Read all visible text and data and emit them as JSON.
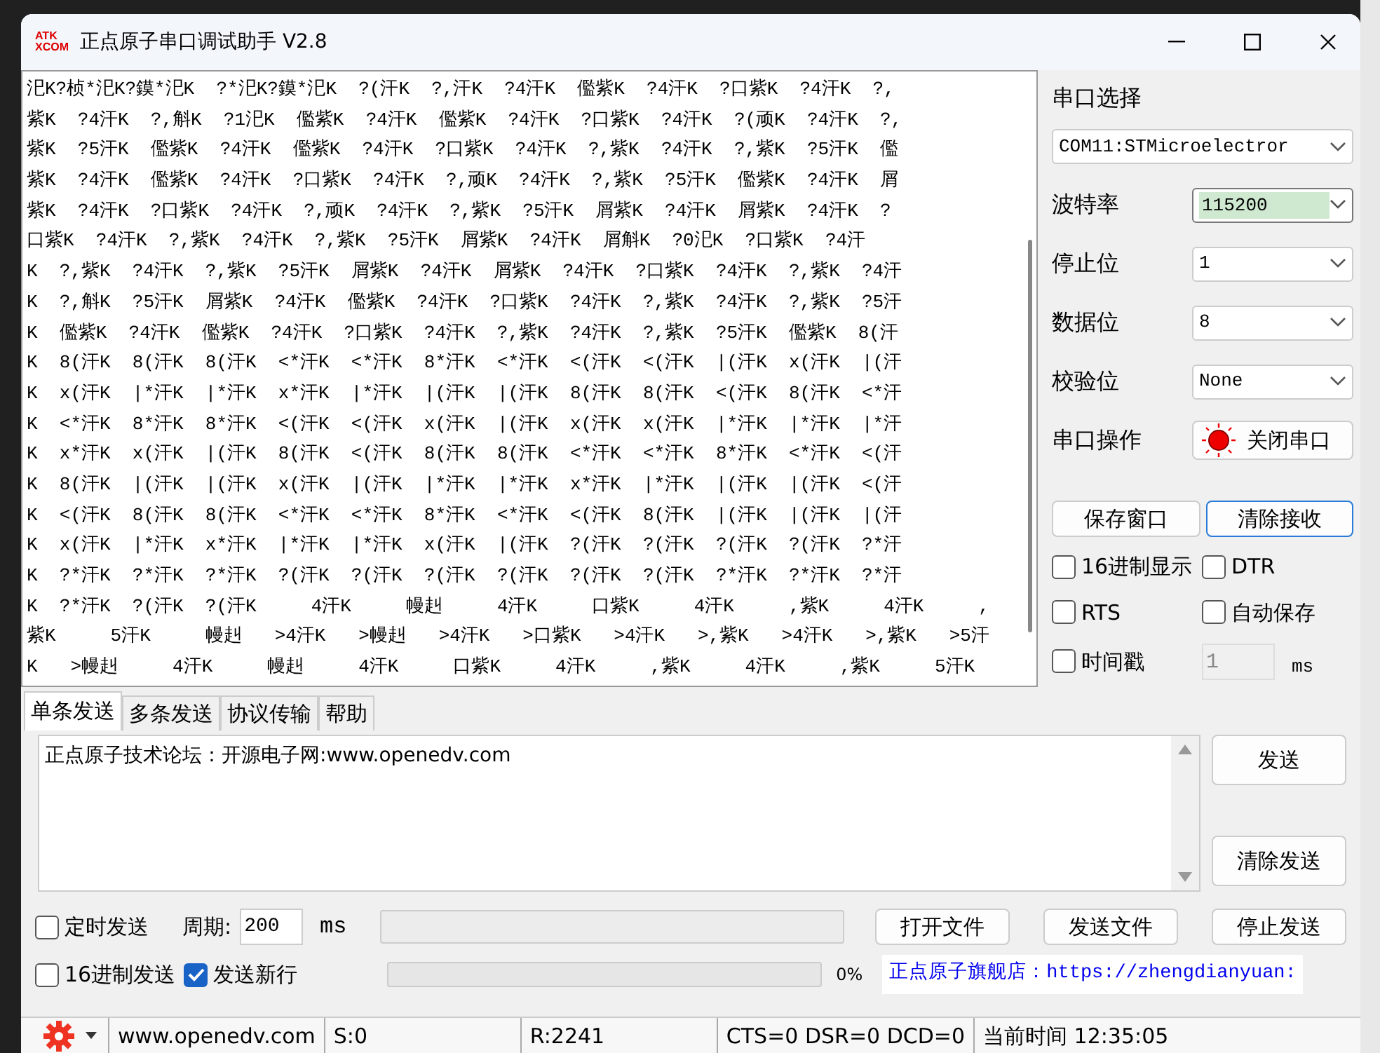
{
  "window": {
    "logo": [
      "ATK",
      "XCOM"
    ],
    "title": "正点原子串口调试助手 V2.8"
  },
  "receive": {
    "lines": [
      "汜K?桢*汜K?鏌*汜K  ?*汜K?鏌*汜K  ?(汗K  ?,汗K  ?4汗K  儖紫K  ?4汗K  ?口紫K  ?4汗K  ?,",
      "紫K  ?4汗K  ?,斛K  ?1汜K  儖紫K  ?4汗K  儖紫K  ?4汗K  ?口紫K  ?4汗K  ?(顽K  ?4汗K  ?,",
      "紫K  ?5汗K  儖紫K  ?4汗K  儖紫K  ?4汗K  ?口紫K  ?4汗K  ?,紫K  ?4汗K  ?,紫K  ?5汗K  儖",
      "紫K  ?4汗K  儖紫K  ?4汗K  ?口紫K  ?4汗K  ?,顽K  ?4汗K  ?,紫K  ?5汗K  儖紫K  ?4汗K  屑",
      "紫K  ?4汗K  ?口紫K  ?4汗K  ?,顽K  ?4汗K  ?,紫K  ?5汗K  屑紫K  ?4汗K  屑紫K  ?4汗K  ?",
      "口紫K  ?4汗K  ?,紫K  ?4汗K  ?,紫K  ?5汗K  屑紫K  ?4汗K  屑斛K  ?0汜K  ?口紫K  ?4汗",
      "K  ?,紫K  ?4汗K  ?,紫K  ?5汗K  屑紫K  ?4汗K  屑紫K  ?4汗K  ?口紫K  ?4汗K  ?,紫K  ?4汗",
      "K  ?,斛K  ?5汗K  屑紫K  ?4汗K  儖紫K  ?4汗K  ?口紫K  ?4汗K  ?,紫K  ?4汗K  ?,紫K  ?5汗",
      "K  儖紫K  ?4汗K  儖紫K  ?4汗K  ?口紫K  ?4汗K  ?,紫K  ?4汗K  ?,紫K  ?5汗K  儖紫K  8(汗",
      "K  8(汗K  8(汗K  8(汗K  <*汗K  <*汗K  8*汗K  <*汗K  <(汗K  <(汗K  |(汗K  x(汗K  |(汗",
      "K  x(汗K  |*汗K  |*汗K  x*汗K  |*汗K  |(汗K  |(汗K  8(汗K  8(汗K  <(汗K  8(汗K  <*汗",
      "K  <*汗K  8*汗K  8*汗K  <(汗K  <(汗K  x(汗K  |(汗K  x(汗K  x(汗K  |*汗K  |*汗K  |*汗",
      "K  x*汗K  x(汗K  |(汗K  8(汗K  <(汗K  8(汗K  8(汗K  <*汗K  <*汗K  8*汗K  <*汗K  <(汗",
      "K  8(汗K  |(汗K  |(汗K  x(汗K  |(汗K  |*汗K  |*汗K  x*汗K  |*汗K  |(汗K  |(汗K  <(汗",
      "K  <(汗K  8(汗K  8(汗K  <*汗K  <*汗K  8*汗K  <*汗K  <(汗K  8(汗K  |(汗K  |(汗K  |(汗",
      "K  x(汗K  |*汗K  x*汗K  |*汗K  |*汗K  x(汗K  |(汗K  ?(汗K  ?(汗K  ?(汗K  ?(汗K  ?*汗",
      "K  ?*汗K  ?*汗K  ?*汗K  ?(汗K  ?(汗K  ?(汗K  ?(汗K  ?(汗K  ?(汗K  ?*汗K  ?*汗K  ?*汗",
      "K  ?*汗K  ?(汗K  ?(汗K     4汗K     幔赳     4汗K     口紫K     4汗K     ,紫K     4汗K     ,",
      "紫K     5汗K     幔赳   >4汗K   >幔赳   >4汗K   >口紫K   >4汗K   >,紫K   >4汗K   >,紫K   >5汗",
      "K   >幔赳     4汗K     幔赳     4汗K     口紫K     4汗K     ,紫K     4汗K     ,紫K     5汗K"
    ]
  },
  "port": {
    "label": "串口选择",
    "value": "COM11:STMicroelectror"
  },
  "settings": [
    {
      "label": "波特率",
      "value": "115200",
      "focused": true
    },
    {
      "label": "停止位",
      "value": "1",
      "focused": false
    },
    {
      "label": "数据位",
      "value": "8",
      "focused": false
    },
    {
      "label": "校验位",
      "value": "None",
      "focused": false
    }
  ],
  "port_operation": {
    "label": "串口操作",
    "button": "关闭串口",
    "open": true
  },
  "receive_buttons": [
    {
      "label": "保存窗口",
      "focused": false
    },
    {
      "label": "清除接收",
      "focused": true
    }
  ],
  "receive_options": [
    {
      "label": "16进制显示",
      "checked": false
    },
    {
      "label": "DTR",
      "checked": false
    },
    {
      "label": "RTS",
      "checked": false
    },
    {
      "label": "自动保存",
      "checked": false
    },
    {
      "label": "时间戳",
      "checked": false
    }
  ],
  "timestamp_interval": {
    "value": "1",
    "unit": "ms"
  },
  "tabs": [
    {
      "label": "单条发送",
      "selected": true
    },
    {
      "label": "多条发送",
      "selected": false
    },
    {
      "label": "协议传输",
      "selected": false
    },
    {
      "label": "帮助",
      "selected": false
    }
  ],
  "send": {
    "text": "正点原子技术论坛：开源电子网:www.openedv.com"
  },
  "send_buttons": [
    "发送",
    "清除发送"
  ],
  "timer": {
    "label": "定时发送",
    "checked": false,
    "period_label": "周期:",
    "period": "200",
    "unit": "ms"
  },
  "file_buttons": [
    "打开文件",
    "发送文件",
    "停止发送"
  ],
  "hex_send": {
    "label": "16进制发送",
    "checked": false
  },
  "newline": {
    "label": "发送新行",
    "checked": true
  },
  "progress": {
    "level": 0,
    "reading": "0%"
  },
  "shop_link": "正点原子旗舰店：https://zhengdianyuan:",
  "status_bar": {
    "items": [
      "www.openedv.com",
      "S:0",
      "R:2241",
      "CTS=0 DSR=0 DCD=0",
      "当前时间 12:35:05"
    ]
  }
}
